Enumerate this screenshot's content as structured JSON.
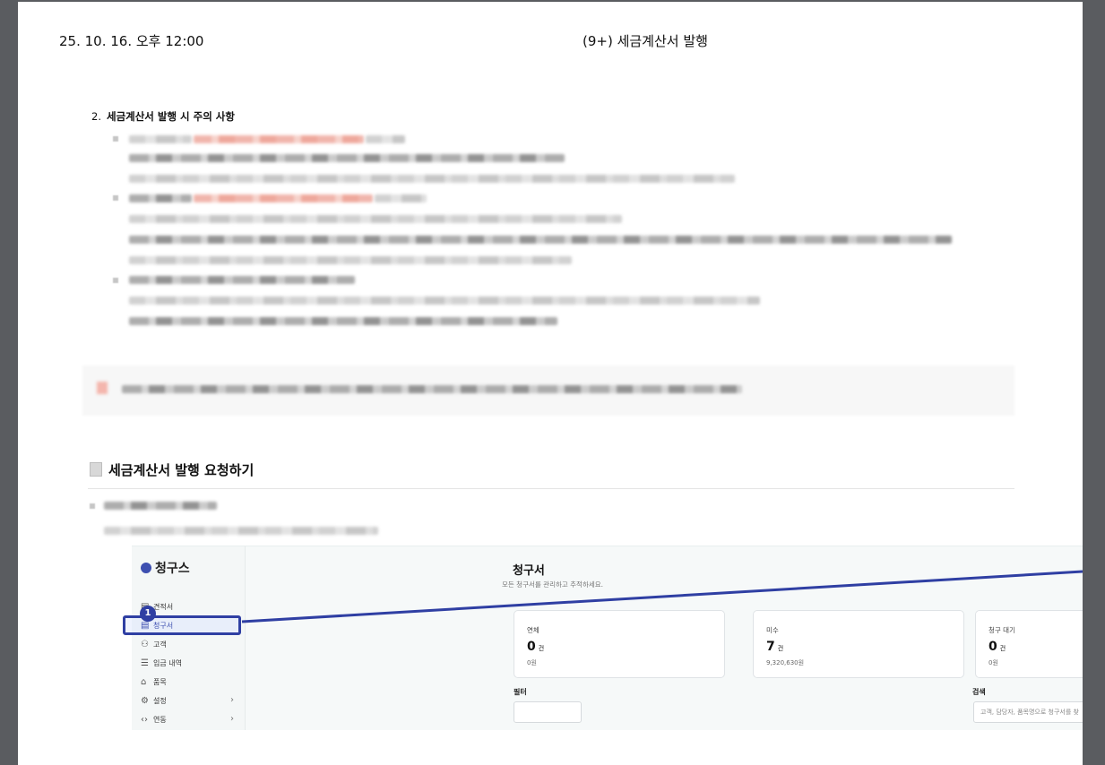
{
  "header": {
    "date": "25. 10. 16. 오후 12:00",
    "title": "(9+) 세금계산서 발행"
  },
  "section2": {
    "number": "2.",
    "title": "세금계산서 발행 시 주의 사항"
  },
  "request_heading": "세금계산서 발행 요청하기",
  "app": {
    "brand": "청구스",
    "nav": [
      {
        "label": "견적서",
        "icon": "doc-icon"
      },
      {
        "label": "청구서",
        "icon": "invoice-icon"
      },
      {
        "label": "고객",
        "icon": "users-icon"
      },
      {
        "label": "입금 내역",
        "icon": "list-icon"
      },
      {
        "label": "품목",
        "icon": "bag-icon"
      },
      {
        "label": "설정",
        "icon": "gear-icon",
        "chevron": "›"
      },
      {
        "label": "연동",
        "icon": "code-icon",
        "chevron": "›"
      }
    ],
    "step_badge": "1",
    "page_title": "청구서",
    "page_subtitle": "모든 청구서를 관리하고 추적하세요.",
    "cards": [
      {
        "label": "연체",
        "value": "0",
        "unit": "건",
        "amount": "0원"
      },
      {
        "label": "미수",
        "value": "7",
        "unit": "건",
        "amount": "9,320,630원"
      },
      {
        "label": "청구 대기",
        "value": "0",
        "unit": "건",
        "amount": "0원"
      }
    ],
    "filter_label": "필터",
    "search_label": "검색",
    "search_placeholder": "고객, 담당자, 품목명으로 청구서를 찾"
  },
  "colors": {
    "accent": "#2f3fa3",
    "brand": "#3d4fb0"
  }
}
